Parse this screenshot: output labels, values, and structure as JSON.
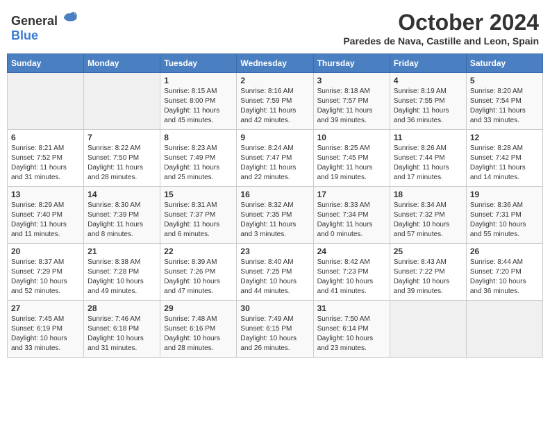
{
  "header": {
    "logo_general": "General",
    "logo_blue": "Blue",
    "month_title": "October 2024",
    "location": "Paredes de Nava, Castille and Leon, Spain"
  },
  "days_of_week": [
    "Sunday",
    "Monday",
    "Tuesday",
    "Wednesday",
    "Thursday",
    "Friday",
    "Saturday"
  ],
  "weeks": [
    [
      {
        "day": "",
        "empty": true
      },
      {
        "day": "",
        "empty": true
      },
      {
        "day": "1",
        "sunrise": "Sunrise: 8:15 AM",
        "sunset": "Sunset: 8:00 PM",
        "daylight": "Daylight: 11 hours and 45 minutes."
      },
      {
        "day": "2",
        "sunrise": "Sunrise: 8:16 AM",
        "sunset": "Sunset: 7:59 PM",
        "daylight": "Daylight: 11 hours and 42 minutes."
      },
      {
        "day": "3",
        "sunrise": "Sunrise: 8:18 AM",
        "sunset": "Sunset: 7:57 PM",
        "daylight": "Daylight: 11 hours and 39 minutes."
      },
      {
        "day": "4",
        "sunrise": "Sunrise: 8:19 AM",
        "sunset": "Sunset: 7:55 PM",
        "daylight": "Daylight: 11 hours and 36 minutes."
      },
      {
        "day": "5",
        "sunrise": "Sunrise: 8:20 AM",
        "sunset": "Sunset: 7:54 PM",
        "daylight": "Daylight: 11 hours and 33 minutes."
      }
    ],
    [
      {
        "day": "6",
        "sunrise": "Sunrise: 8:21 AM",
        "sunset": "Sunset: 7:52 PM",
        "daylight": "Daylight: 11 hours and 31 minutes."
      },
      {
        "day": "7",
        "sunrise": "Sunrise: 8:22 AM",
        "sunset": "Sunset: 7:50 PM",
        "daylight": "Daylight: 11 hours and 28 minutes."
      },
      {
        "day": "8",
        "sunrise": "Sunrise: 8:23 AM",
        "sunset": "Sunset: 7:49 PM",
        "daylight": "Daylight: 11 hours and 25 minutes."
      },
      {
        "day": "9",
        "sunrise": "Sunrise: 8:24 AM",
        "sunset": "Sunset: 7:47 PM",
        "daylight": "Daylight: 11 hours and 22 minutes."
      },
      {
        "day": "10",
        "sunrise": "Sunrise: 8:25 AM",
        "sunset": "Sunset: 7:45 PM",
        "daylight": "Daylight: 11 hours and 19 minutes."
      },
      {
        "day": "11",
        "sunrise": "Sunrise: 8:26 AM",
        "sunset": "Sunset: 7:44 PM",
        "daylight": "Daylight: 11 hours and 17 minutes."
      },
      {
        "day": "12",
        "sunrise": "Sunrise: 8:28 AM",
        "sunset": "Sunset: 7:42 PM",
        "daylight": "Daylight: 11 hours and 14 minutes."
      }
    ],
    [
      {
        "day": "13",
        "sunrise": "Sunrise: 8:29 AM",
        "sunset": "Sunset: 7:40 PM",
        "daylight": "Daylight: 11 hours and 11 minutes."
      },
      {
        "day": "14",
        "sunrise": "Sunrise: 8:30 AM",
        "sunset": "Sunset: 7:39 PM",
        "daylight": "Daylight: 11 hours and 8 minutes."
      },
      {
        "day": "15",
        "sunrise": "Sunrise: 8:31 AM",
        "sunset": "Sunset: 7:37 PM",
        "daylight": "Daylight: 11 hours and 6 minutes."
      },
      {
        "day": "16",
        "sunrise": "Sunrise: 8:32 AM",
        "sunset": "Sunset: 7:35 PM",
        "daylight": "Daylight: 11 hours and 3 minutes."
      },
      {
        "day": "17",
        "sunrise": "Sunrise: 8:33 AM",
        "sunset": "Sunset: 7:34 PM",
        "daylight": "Daylight: 11 hours and 0 minutes."
      },
      {
        "day": "18",
        "sunrise": "Sunrise: 8:34 AM",
        "sunset": "Sunset: 7:32 PM",
        "daylight": "Daylight: 10 hours and 57 minutes."
      },
      {
        "day": "19",
        "sunrise": "Sunrise: 8:36 AM",
        "sunset": "Sunset: 7:31 PM",
        "daylight": "Daylight: 10 hours and 55 minutes."
      }
    ],
    [
      {
        "day": "20",
        "sunrise": "Sunrise: 8:37 AM",
        "sunset": "Sunset: 7:29 PM",
        "daylight": "Daylight: 10 hours and 52 minutes."
      },
      {
        "day": "21",
        "sunrise": "Sunrise: 8:38 AM",
        "sunset": "Sunset: 7:28 PM",
        "daylight": "Daylight: 10 hours and 49 minutes."
      },
      {
        "day": "22",
        "sunrise": "Sunrise: 8:39 AM",
        "sunset": "Sunset: 7:26 PM",
        "daylight": "Daylight: 10 hours and 47 minutes."
      },
      {
        "day": "23",
        "sunrise": "Sunrise: 8:40 AM",
        "sunset": "Sunset: 7:25 PM",
        "daylight": "Daylight: 10 hours and 44 minutes."
      },
      {
        "day": "24",
        "sunrise": "Sunrise: 8:42 AM",
        "sunset": "Sunset: 7:23 PM",
        "daylight": "Daylight: 10 hours and 41 minutes."
      },
      {
        "day": "25",
        "sunrise": "Sunrise: 8:43 AM",
        "sunset": "Sunset: 7:22 PM",
        "daylight": "Daylight: 10 hours and 39 minutes."
      },
      {
        "day": "26",
        "sunrise": "Sunrise: 8:44 AM",
        "sunset": "Sunset: 7:20 PM",
        "daylight": "Daylight: 10 hours and 36 minutes."
      }
    ],
    [
      {
        "day": "27",
        "sunrise": "Sunrise: 7:45 AM",
        "sunset": "Sunset: 6:19 PM",
        "daylight": "Daylight: 10 hours and 33 minutes."
      },
      {
        "day": "28",
        "sunrise": "Sunrise: 7:46 AM",
        "sunset": "Sunset: 6:18 PM",
        "daylight": "Daylight: 10 hours and 31 minutes."
      },
      {
        "day": "29",
        "sunrise": "Sunrise: 7:48 AM",
        "sunset": "Sunset: 6:16 PM",
        "daylight": "Daylight: 10 hours and 28 minutes."
      },
      {
        "day": "30",
        "sunrise": "Sunrise: 7:49 AM",
        "sunset": "Sunset: 6:15 PM",
        "daylight": "Daylight: 10 hours and 26 minutes."
      },
      {
        "day": "31",
        "sunrise": "Sunrise: 7:50 AM",
        "sunset": "Sunset: 6:14 PM",
        "daylight": "Daylight: 10 hours and 23 minutes."
      },
      {
        "day": "",
        "empty": true
      },
      {
        "day": "",
        "empty": true
      }
    ]
  ]
}
